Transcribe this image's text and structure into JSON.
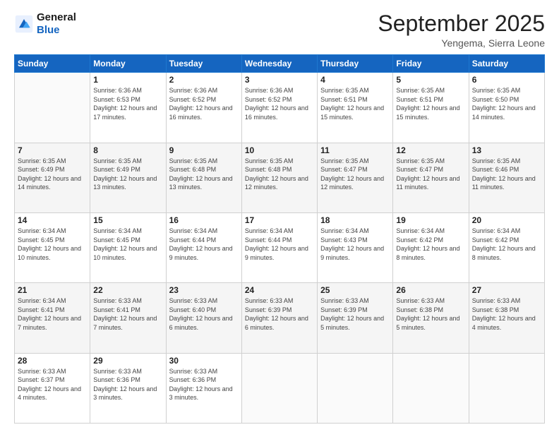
{
  "header": {
    "logo_general": "General",
    "logo_blue": "Blue",
    "month": "September 2025",
    "location": "Yengema, Sierra Leone"
  },
  "days_of_week": [
    "Sunday",
    "Monday",
    "Tuesday",
    "Wednesday",
    "Thursday",
    "Friday",
    "Saturday"
  ],
  "weeks": [
    [
      {
        "day": "",
        "sunrise": "",
        "sunset": "",
        "daylight": ""
      },
      {
        "day": "1",
        "sunrise": "Sunrise: 6:36 AM",
        "sunset": "Sunset: 6:53 PM",
        "daylight": "Daylight: 12 hours and 17 minutes."
      },
      {
        "day": "2",
        "sunrise": "Sunrise: 6:36 AM",
        "sunset": "Sunset: 6:52 PM",
        "daylight": "Daylight: 12 hours and 16 minutes."
      },
      {
        "day": "3",
        "sunrise": "Sunrise: 6:36 AM",
        "sunset": "Sunset: 6:52 PM",
        "daylight": "Daylight: 12 hours and 16 minutes."
      },
      {
        "day": "4",
        "sunrise": "Sunrise: 6:35 AM",
        "sunset": "Sunset: 6:51 PM",
        "daylight": "Daylight: 12 hours and 15 minutes."
      },
      {
        "day": "5",
        "sunrise": "Sunrise: 6:35 AM",
        "sunset": "Sunset: 6:51 PM",
        "daylight": "Daylight: 12 hours and 15 minutes."
      },
      {
        "day": "6",
        "sunrise": "Sunrise: 6:35 AM",
        "sunset": "Sunset: 6:50 PM",
        "daylight": "Daylight: 12 hours and 14 minutes."
      }
    ],
    [
      {
        "day": "7",
        "sunrise": "Sunrise: 6:35 AM",
        "sunset": "Sunset: 6:49 PM",
        "daylight": "Daylight: 12 hours and 14 minutes."
      },
      {
        "day": "8",
        "sunrise": "Sunrise: 6:35 AM",
        "sunset": "Sunset: 6:49 PM",
        "daylight": "Daylight: 12 hours and 13 minutes."
      },
      {
        "day": "9",
        "sunrise": "Sunrise: 6:35 AM",
        "sunset": "Sunset: 6:48 PM",
        "daylight": "Daylight: 12 hours and 13 minutes."
      },
      {
        "day": "10",
        "sunrise": "Sunrise: 6:35 AM",
        "sunset": "Sunset: 6:48 PM",
        "daylight": "Daylight: 12 hours and 12 minutes."
      },
      {
        "day": "11",
        "sunrise": "Sunrise: 6:35 AM",
        "sunset": "Sunset: 6:47 PM",
        "daylight": "Daylight: 12 hours and 12 minutes."
      },
      {
        "day": "12",
        "sunrise": "Sunrise: 6:35 AM",
        "sunset": "Sunset: 6:47 PM",
        "daylight": "Daylight: 12 hours and 11 minutes."
      },
      {
        "day": "13",
        "sunrise": "Sunrise: 6:35 AM",
        "sunset": "Sunset: 6:46 PM",
        "daylight": "Daylight: 12 hours and 11 minutes."
      }
    ],
    [
      {
        "day": "14",
        "sunrise": "Sunrise: 6:34 AM",
        "sunset": "Sunset: 6:45 PM",
        "daylight": "Daylight: 12 hours and 10 minutes."
      },
      {
        "day": "15",
        "sunrise": "Sunrise: 6:34 AM",
        "sunset": "Sunset: 6:45 PM",
        "daylight": "Daylight: 12 hours and 10 minutes."
      },
      {
        "day": "16",
        "sunrise": "Sunrise: 6:34 AM",
        "sunset": "Sunset: 6:44 PM",
        "daylight": "Daylight: 12 hours and 9 minutes."
      },
      {
        "day": "17",
        "sunrise": "Sunrise: 6:34 AM",
        "sunset": "Sunset: 6:44 PM",
        "daylight": "Daylight: 12 hours and 9 minutes."
      },
      {
        "day": "18",
        "sunrise": "Sunrise: 6:34 AM",
        "sunset": "Sunset: 6:43 PM",
        "daylight": "Daylight: 12 hours and 9 minutes."
      },
      {
        "day": "19",
        "sunrise": "Sunrise: 6:34 AM",
        "sunset": "Sunset: 6:42 PM",
        "daylight": "Daylight: 12 hours and 8 minutes."
      },
      {
        "day": "20",
        "sunrise": "Sunrise: 6:34 AM",
        "sunset": "Sunset: 6:42 PM",
        "daylight": "Daylight: 12 hours and 8 minutes."
      }
    ],
    [
      {
        "day": "21",
        "sunrise": "Sunrise: 6:34 AM",
        "sunset": "Sunset: 6:41 PM",
        "daylight": "Daylight: 12 hours and 7 minutes."
      },
      {
        "day": "22",
        "sunrise": "Sunrise: 6:33 AM",
        "sunset": "Sunset: 6:41 PM",
        "daylight": "Daylight: 12 hours and 7 minutes."
      },
      {
        "day": "23",
        "sunrise": "Sunrise: 6:33 AM",
        "sunset": "Sunset: 6:40 PM",
        "daylight": "Daylight: 12 hours and 6 minutes."
      },
      {
        "day": "24",
        "sunrise": "Sunrise: 6:33 AM",
        "sunset": "Sunset: 6:39 PM",
        "daylight": "Daylight: 12 hours and 6 minutes."
      },
      {
        "day": "25",
        "sunrise": "Sunrise: 6:33 AM",
        "sunset": "Sunset: 6:39 PM",
        "daylight": "Daylight: 12 hours and 5 minutes."
      },
      {
        "day": "26",
        "sunrise": "Sunrise: 6:33 AM",
        "sunset": "Sunset: 6:38 PM",
        "daylight": "Daylight: 12 hours and 5 minutes."
      },
      {
        "day": "27",
        "sunrise": "Sunrise: 6:33 AM",
        "sunset": "Sunset: 6:38 PM",
        "daylight": "Daylight: 12 hours and 4 minutes."
      }
    ],
    [
      {
        "day": "28",
        "sunrise": "Sunrise: 6:33 AM",
        "sunset": "Sunset: 6:37 PM",
        "daylight": "Daylight: 12 hours and 4 minutes."
      },
      {
        "day": "29",
        "sunrise": "Sunrise: 6:33 AM",
        "sunset": "Sunset: 6:36 PM",
        "daylight": "Daylight: 12 hours and 3 minutes."
      },
      {
        "day": "30",
        "sunrise": "Sunrise: 6:33 AM",
        "sunset": "Sunset: 6:36 PM",
        "daylight": "Daylight: 12 hours and 3 minutes."
      },
      {
        "day": "",
        "sunrise": "",
        "sunset": "",
        "daylight": ""
      },
      {
        "day": "",
        "sunrise": "",
        "sunset": "",
        "daylight": ""
      },
      {
        "day": "",
        "sunrise": "",
        "sunset": "",
        "daylight": ""
      },
      {
        "day": "",
        "sunrise": "",
        "sunset": "",
        "daylight": ""
      }
    ]
  ]
}
